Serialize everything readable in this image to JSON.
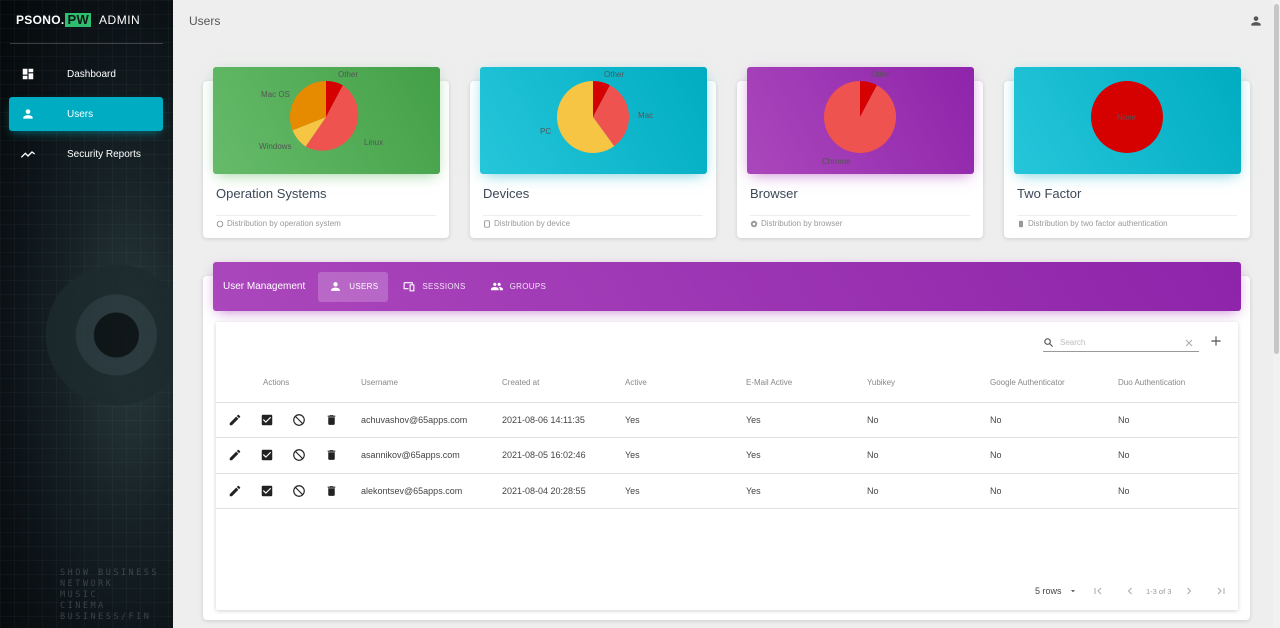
{
  "sidebar": {
    "logo_brand": "PSONO",
    "logo_tld": "PW",
    "logo_suffix": "ADMIN",
    "items": [
      {
        "label": "Dashboard",
        "icon": "dashboard-icon"
      },
      {
        "label": "Users",
        "icon": "person-icon",
        "active": true
      },
      {
        "label": "Security Reports",
        "icon": "trending-icon"
      }
    ],
    "background_text": [
      "SHOW BUSINESS",
      "NETWORK",
      "MUSIC",
      "CINEMA",
      "BUSINESS/FIN"
    ]
  },
  "header": {
    "title": "Users"
  },
  "cards": [
    {
      "title": "Operation Systems",
      "footer": "Distribution by operation system",
      "color": "#4caf50",
      "pie_labels": [
        "Other",
        "Mac OS",
        "Windows",
        "Linux"
      ]
    },
    {
      "title": "Devices",
      "footer": "Distribution by device",
      "color": "#00acc1",
      "pie_labels": [
        "Other",
        "Mac",
        "PC"
      ]
    },
    {
      "title": "Browser",
      "footer": "Distribution by browser",
      "color": "#9c27b0",
      "pie_labels": [
        "Other",
        "Chrome"
      ]
    },
    {
      "title": "Two Factor",
      "footer": "Distribution by two factor authentication",
      "color": "#00acc1",
      "pie_labels": [
        "None"
      ]
    }
  ],
  "management": {
    "title": "User Management",
    "tabs": [
      {
        "label": "USERS",
        "icon": "person-icon",
        "active": true
      },
      {
        "label": "SESSIONS",
        "icon": "devices-icon"
      },
      {
        "label": "GROUPS",
        "icon": "group-icon"
      }
    ],
    "search_placeholder": "Search",
    "columns": [
      "Actions",
      "Username",
      "Created at",
      "Active",
      "E-Mail Active",
      "Yubikey",
      "Google Authenticator",
      "Duo Authentication"
    ],
    "rows": [
      {
        "username": "achuvashov@65apps.com",
        "created_at": "2021-08-06 14:11:35",
        "active": "Yes",
        "email_active": "Yes",
        "yubikey": "No",
        "google_auth": "No",
        "duo_auth": "No"
      },
      {
        "username": "asannikov@65apps.com",
        "created_at": "2021-08-05 16:02:46",
        "active": "Yes",
        "email_active": "Yes",
        "yubikey": "No",
        "google_auth": "No",
        "duo_auth": "No"
      },
      {
        "username": "alekontsev@65apps.com",
        "created_at": "2021-08-04 20:28:55",
        "active": "Yes",
        "email_active": "Yes",
        "yubikey": "No",
        "google_auth": "No",
        "duo_auth": "No"
      }
    ],
    "pagination": {
      "rows_per_page": "5 rows",
      "range": "1-3 of 3"
    }
  },
  "colors": {
    "accent_cyan": "#00acc1",
    "accent_purple": "#9c27b0",
    "accent_green": "#4caf50",
    "pie_red": "#ef5350",
    "pie_dark_red": "#d50000",
    "pie_orange": "#e68a00",
    "pie_yellow": "#f6c544"
  }
}
